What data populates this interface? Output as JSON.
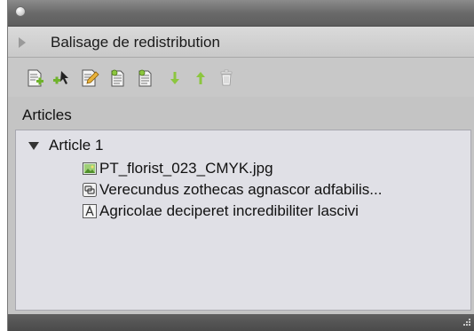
{
  "panel": {
    "title": "Balisage de redistribution",
    "section_label": "Articles"
  },
  "toolbar": {
    "buttons": [
      {
        "icon": "new-article-icon"
      },
      {
        "icon": "add-to-article-icon"
      },
      {
        "icon": "edit-article-icon"
      },
      {
        "icon": "article-options-icon"
      },
      {
        "icon": "article-options-2-icon"
      },
      {
        "icon": "move-down-icon"
      },
      {
        "icon": "move-up-icon"
      },
      {
        "icon": "trash-icon"
      }
    ]
  },
  "tree": {
    "article": {
      "label": "Article 1",
      "expanded": true,
      "items": [
        {
          "label": "PT_florist_023_CMYK.jpg",
          "icon": "image-icon"
        },
        {
          "label": "Verecundus zothecas agnascor adfabilis...",
          "icon": "linked-text-icon"
        },
        {
          "label": "Agricolae deciperet incredibiliter lascivi",
          "icon": "text-frame-icon"
        }
      ]
    }
  },
  "colors": {
    "panel_bg": "#c4c4c4",
    "list_bg": "#e0e0e6",
    "titlebar": "#6a6a6a",
    "icon_green": "#8cc63f"
  }
}
